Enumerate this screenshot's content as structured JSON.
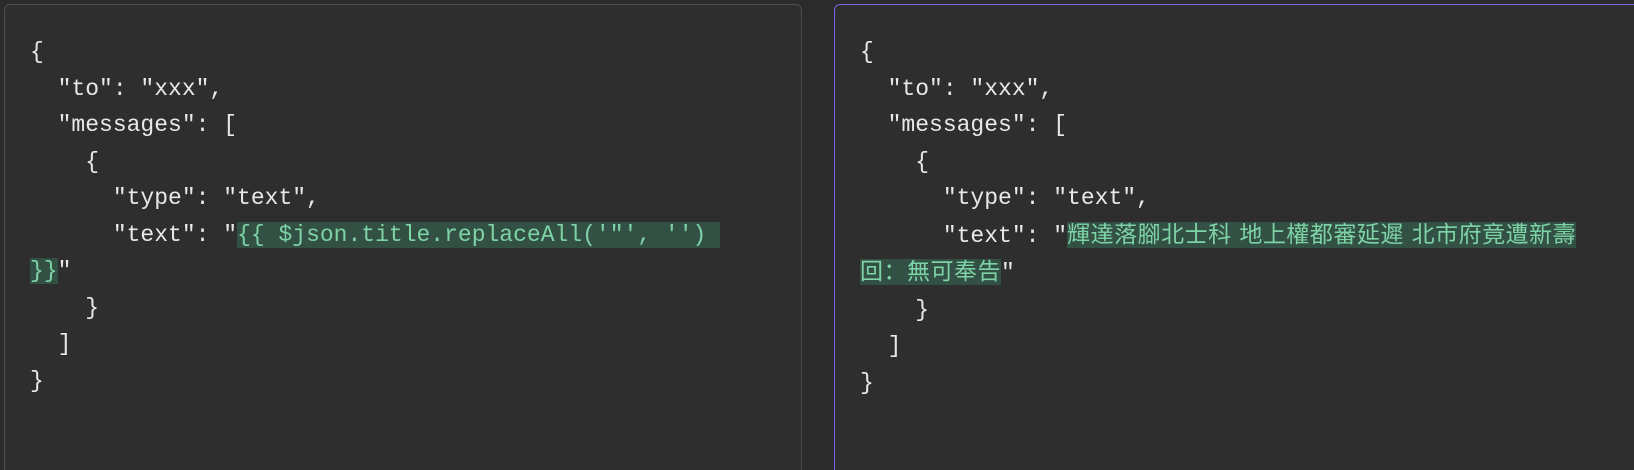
{
  "editor": {
    "lines": [
      "{",
      "  \"to\": \"xxx\",",
      "  \"messages\": [",
      "    {",
      "      \"type\": \"text\","
    ],
    "text_line_prefix": "      \"text\": \"",
    "expression": "{{ $json.title.replaceAll('\"', '') }}",
    "text_line_suffix": "\"",
    "closing_lines": [
      "    }",
      "  ]",
      "}"
    ]
  },
  "preview": {
    "lines": [
      "{",
      "  \"to\": \"xxx\",",
      "  \"messages\": [",
      "    {",
      "      \"type\": \"text\","
    ],
    "text_line_prefix": "      \"text\": \"",
    "resolved_value": "輝達落腳北士科 地上權都審延遲 北市府竟遭新壽回：無可奉告",
    "text_line_suffix": "\"",
    "closing_lines": [
      "    }",
      "  ]",
      "}"
    ]
  },
  "colors": {
    "background": "#2e2e2e",
    "highlight_bg": "#335044",
    "highlight_text": "#7ed3a6",
    "active_border": "#7a66e0"
  }
}
